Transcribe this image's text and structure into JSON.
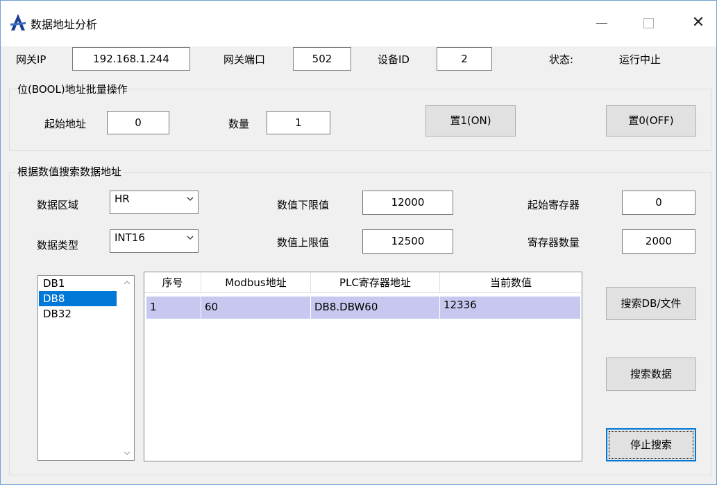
{
  "window": {
    "title": "数据地址分析",
    "minimize": "minimize",
    "maximize": "maximize",
    "close": "✕"
  },
  "connection": {
    "gateway_ip_label": "网关IP",
    "gateway_ip": "192.168.1.244",
    "gateway_port_label": "网关端口",
    "gateway_port": "502",
    "device_id_label": "设备ID",
    "device_id": "2",
    "status_label": "状态:",
    "status_value": "运行中止"
  },
  "bool_group": {
    "title": "位(BOOL)地址批量操作",
    "start_label": "起始地址",
    "start_value": "0",
    "count_label": "数量",
    "count_value": "1",
    "set_on": "置1(ON)",
    "set_off": "置0(OFF)"
  },
  "search_group": {
    "title": "根据数值搜索数据地址",
    "area_label": "数据区域",
    "area_value": "HR",
    "type_label": "数据类型",
    "type_value": "INT16",
    "min_label": "数值下限值",
    "min_value": "12000",
    "max_label": "数值上限值",
    "max_value": "12500",
    "start_reg_label": "起始寄存器",
    "start_reg_value": "0",
    "reg_count_label": "寄存器数量",
    "reg_count_value": "2000",
    "db_list": [
      "DB1",
      "DB8",
      "DB32"
    ],
    "db_selected": "DB8",
    "table": {
      "headers": [
        "序号",
        "Modbus地址",
        "PLC寄存器地址",
        "当前数值"
      ],
      "rows": [
        [
          "1",
          "60",
          "DB8.DBW60",
          "12336"
        ]
      ]
    },
    "search_db_button": "搜索DB/文件",
    "search_data_button": "搜索数据",
    "stop_search_button": "停止搜索"
  },
  "colors": {
    "selection": "#0078d7",
    "row_highlight": "#c7c7f0",
    "window_border": "#6f9fd5"
  }
}
